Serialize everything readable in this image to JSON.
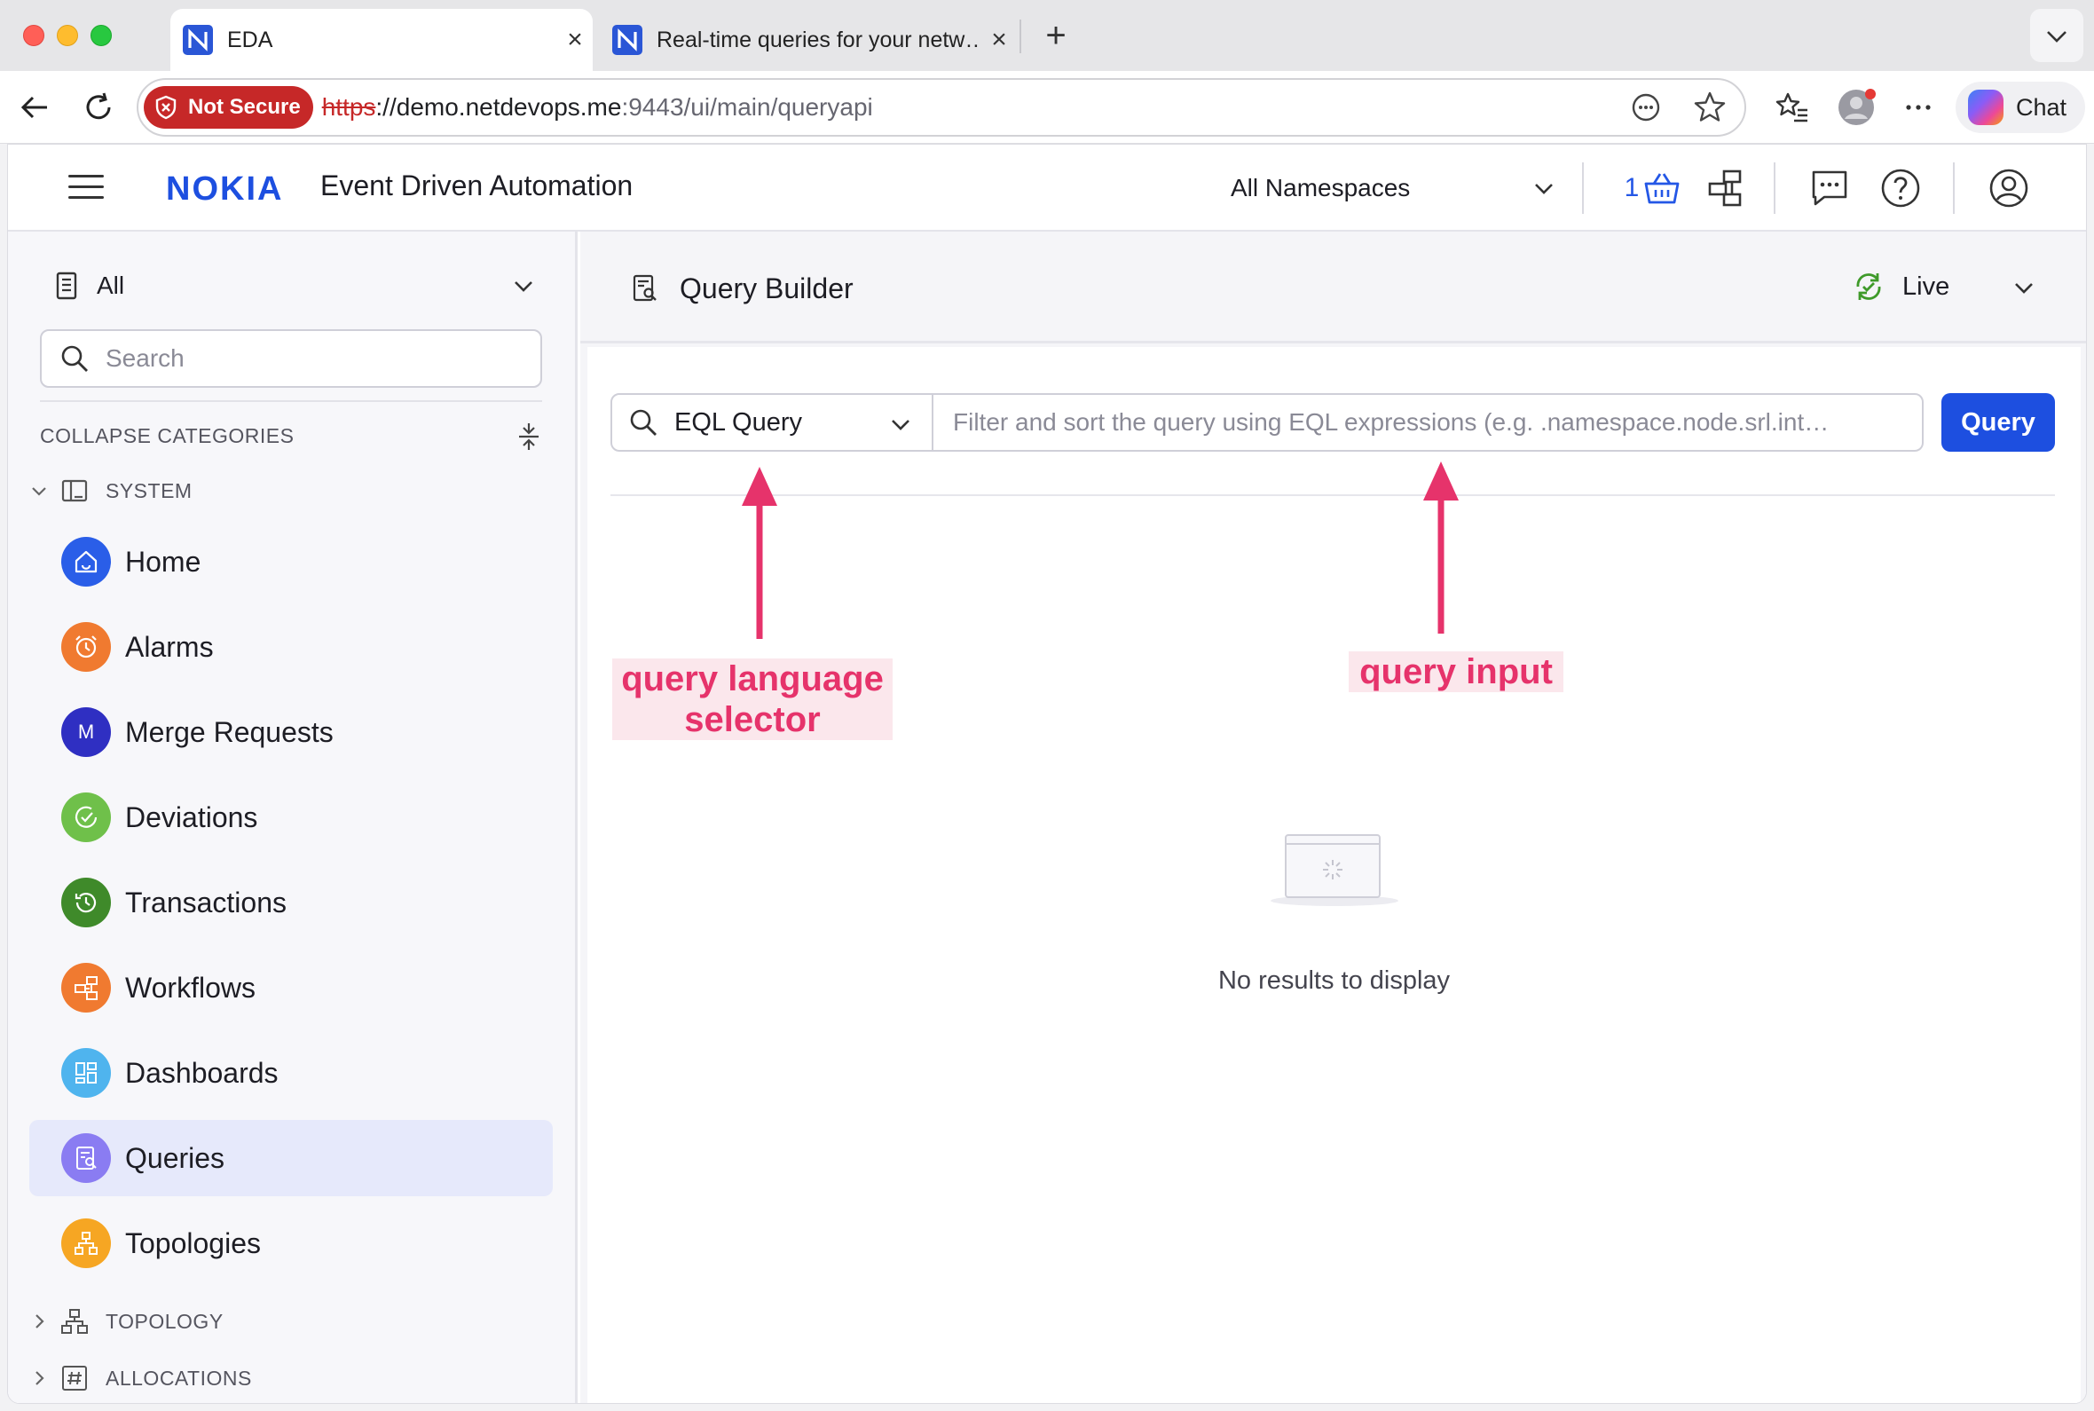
{
  "browser": {
    "tabs": [
      {
        "title": "EDA",
        "active": true
      },
      {
        "title": "Real-time queries for your netw…",
        "active": false
      }
    ],
    "security_badge": "Not Secure",
    "url": {
      "scheme": "https",
      "rest_host": "://demo.netdevops.me",
      "rest_path": ":9443/ui/main/queryapi"
    },
    "chat_label": "Chat"
  },
  "app": {
    "brand": "NOKIA",
    "title": "Event Driven Automation",
    "namespace": "All Namespaces",
    "basket_count": "1"
  },
  "sidebar": {
    "filter": "All",
    "search_placeholder": "Search",
    "collapse_label": "COLLAPSE CATEGORIES",
    "categories": {
      "system": "SYSTEM",
      "topology": "TOPOLOGY",
      "allocations": "ALLOCATIONS"
    },
    "items": [
      {
        "label": "Home",
        "color": "#2a5ee8",
        "icon": "home-icon"
      },
      {
        "label": "Alarms",
        "color": "#f07a30",
        "icon": "alarm-clock-icon"
      },
      {
        "label": "Merge Requests",
        "color": "#2f2fc2",
        "icon": "letter-m-icon",
        "glyph": "M"
      },
      {
        "label": "Deviations",
        "color": "#6fc04a",
        "icon": "deviation-check-icon"
      },
      {
        "label": "Transactions",
        "color": "#3f8a2a",
        "icon": "history-icon"
      },
      {
        "label": "Workflows",
        "color": "#f07a30",
        "icon": "workflow-icon"
      },
      {
        "label": "Dashboards",
        "color": "#4fb4ee",
        "icon": "dashboard-icon"
      },
      {
        "label": "Queries",
        "color": "#8a7cf2",
        "icon": "query-icon",
        "selected": true
      },
      {
        "label": "Topologies",
        "color": "#f6a623",
        "icon": "topology-icon"
      }
    ]
  },
  "main": {
    "page_title": "Query Builder",
    "live_label": "Live",
    "query_language": "EQL Query",
    "query_placeholder": "Filter and sort the query using EQL expressions (e.g. .namespace.node.srl.int…",
    "query_button": "Query",
    "empty_text": "No results to display"
  },
  "annotations": {
    "selector_label_line1": "query language",
    "selector_label_line2": "selector",
    "input_label": "query input",
    "color": "#e6336b"
  }
}
